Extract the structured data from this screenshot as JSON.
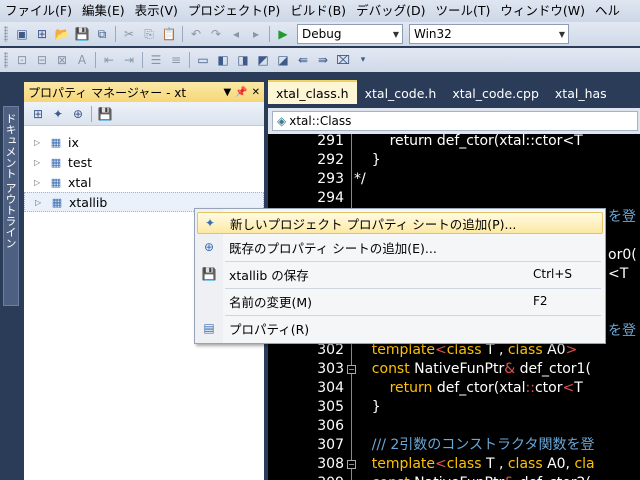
{
  "menubar": {
    "items": [
      "ファイル(F)",
      "編集(E)",
      "表示(V)",
      "プロジェクト(P)",
      "ビルド(B)",
      "デバッグ(D)",
      "ツール(T)",
      "ウィンドウ(W)",
      "ヘル"
    ]
  },
  "toolbar": {
    "configuration": "Debug",
    "platform": "Win32"
  },
  "side_tab": {
    "label": "ドキュメント アウトライン"
  },
  "property_manager": {
    "title": "プロパティ マネージャー - xt",
    "tree": [
      {
        "label": "ix"
      },
      {
        "label": "test"
      },
      {
        "label": "xtal"
      },
      {
        "label": "xtallib"
      }
    ]
  },
  "editor": {
    "tabs": [
      "xtal_class.h",
      "xtal_code.h",
      "xtal_code.cpp",
      "xtal_has"
    ],
    "nav_class": "xtal::Class",
    "lines": [
      {
        "no": "291",
        "parts": [
          {
            "t": "        return def_ctor(xtal::ctor<T",
            "c": "plain"
          }
        ]
      },
      {
        "no": "292",
        "parts": [
          {
            "t": "    }",
            "c": "plain"
          }
        ]
      },
      {
        "no": "293",
        "parts": [
          {
            "t": "*/",
            "c": "plain"
          }
        ]
      },
      {
        "no": "294",
        "parts": [
          {
            "t": "",
            "c": "plain"
          }
        ]
      },
      {
        "no": "",
        "parts": [
          {
            "t": "",
            "c": "plain"
          }
        ]
      },
      {
        "no": "",
        "parts": [
          {
            "t": "",
            "c": "plain"
          }
        ]
      },
      {
        "no": "",
        "parts": [
          {
            "t": "",
            "c": "plain"
          }
        ]
      },
      {
        "no": "",
        "parts": [
          {
            "t": "",
            "c": "plain"
          }
        ]
      },
      {
        "no": "",
        "parts": [
          {
            "t": "",
            "c": "plain"
          }
        ]
      },
      {
        "no": "",
        "parts": [
          {
            "t": "",
            "c": "plain"
          }
        ]
      },
      {
        "no": "",
        "parts": [
          {
            "t": "",
            "c": "plain"
          }
        ]
      },
      {
        "no": "302",
        "parts": [
          {
            "t": "    template",
            "c": "kw"
          },
          {
            "t": "<",
            "c": "op"
          },
          {
            "t": "class",
            "c": "kw"
          },
          {
            "t": " T , ",
            "c": "plain"
          },
          {
            "t": "class",
            "c": "kw"
          },
          {
            "t": " A0",
            "c": "plain"
          },
          {
            "t": ">",
            "c": "op"
          }
        ]
      },
      {
        "no": "303",
        "parts": [
          {
            "t": "    const",
            "c": "kw"
          },
          {
            "t": " NativeFunPtr",
            "c": "plain"
          },
          {
            "t": "&",
            "c": "op"
          },
          {
            "t": " def_ctor1(",
            "c": "plain"
          }
        ]
      },
      {
        "no": "304",
        "parts": [
          {
            "t": "        return",
            "c": "kw"
          },
          {
            "t": " def_ctor(xtal",
            "c": "plain"
          },
          {
            "t": "::",
            "c": "op"
          },
          {
            "t": "ctor",
            "c": "plain"
          },
          {
            "t": "<",
            "c": "op"
          },
          {
            "t": "T",
            "c": "plain"
          }
        ]
      },
      {
        "no": "305",
        "parts": [
          {
            "t": "    }",
            "c": "plain"
          }
        ]
      },
      {
        "no": "306",
        "parts": [
          {
            "t": "",
            "c": "plain"
          }
        ]
      },
      {
        "no": "307",
        "parts": [
          {
            "t": "    /// 2引数のコンストラクタ関数を登",
            "c": "cm"
          }
        ]
      },
      {
        "no": "308",
        "parts": [
          {
            "t": "    template",
            "c": "kw"
          },
          {
            "t": "<",
            "c": "op"
          },
          {
            "t": "class",
            "c": "kw"
          },
          {
            "t": " T , ",
            "c": "plain"
          },
          {
            "t": "class",
            "c": "kw"
          },
          {
            "t": " A0, ",
            "c": "plain"
          },
          {
            "t": "cla",
            "c": "kw"
          }
        ]
      },
      {
        "no": "309",
        "parts": [
          {
            "t": "    const",
            "c": "kw"
          },
          {
            "t": " NativeFunPtr",
            "c": "plain"
          },
          {
            "t": "&",
            "c": "op"
          },
          {
            "t": " def_ctor2(",
            "c": "plain"
          }
        ]
      }
    ],
    "peek_fragments": [
      {
        "text": "を登",
        "row": 4
      },
      {
        "text": "or0(",
        "row": 6
      },
      {
        "text": "<T",
        "row": 7
      },
      {
        "text": "を登",
        "row": 10
      }
    ]
  },
  "context_menu": {
    "items": [
      {
        "label": "新しいプロジェクト プロパティ シートの追加(P)...",
        "shortcut": "",
        "icon": "add-new-sheet-icon",
        "highlighted": true
      },
      {
        "label": "既存のプロパティ シートの追加(E)...",
        "shortcut": "",
        "icon": "add-existing-sheet-icon",
        "highlighted": false
      },
      {
        "label": "xtallib の保存",
        "shortcut": "Ctrl+S",
        "icon": "save-icon",
        "highlighted": false
      },
      {
        "label": "名前の変更(M)",
        "shortcut": "F2",
        "icon": "",
        "highlighted": false
      },
      {
        "label": "プロパティ(R)",
        "shortcut": "",
        "icon": "properties-icon",
        "highlighted": false
      }
    ]
  }
}
